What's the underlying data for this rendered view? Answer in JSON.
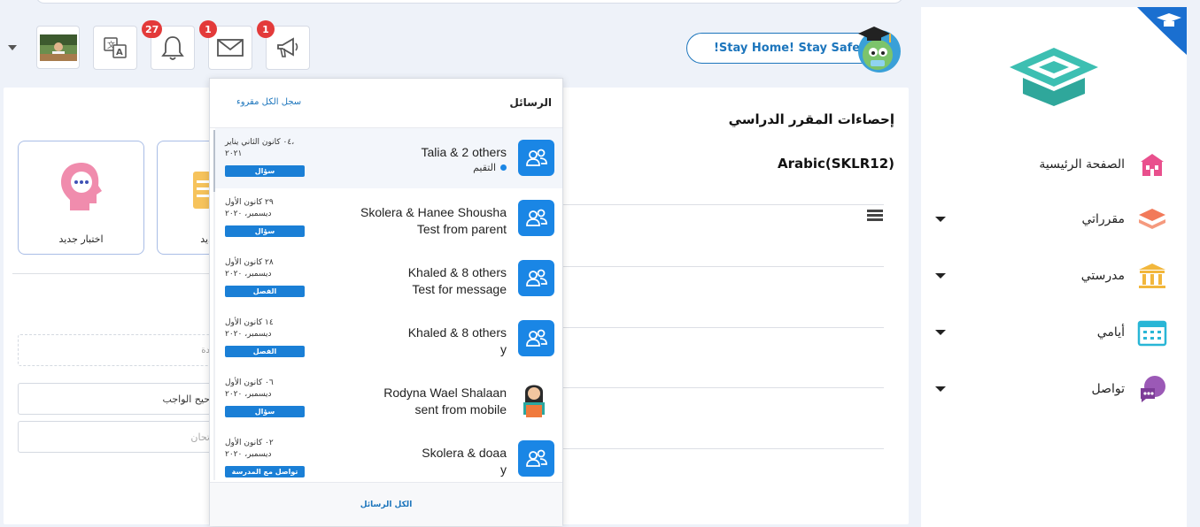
{
  "header": {
    "notifications_count": "27",
    "messages_count": "1",
    "announcements_count": "1",
    "banner_text": "!Stay Home! Stay Safe"
  },
  "sidebar": {
    "items": [
      {
        "label": "الصفحة الرئيسية",
        "icon": "home-icon",
        "color": "#e9508d"
      },
      {
        "label": "مقرراتي",
        "icon": "books-icon",
        "color": "#f27a5a"
      },
      {
        "label": "مدرستي",
        "icon": "school-icon",
        "color": "#f2b73c"
      },
      {
        "label": "أيامي",
        "icon": "calendar-icon",
        "color": "#29b6d6"
      },
      {
        "label": "تواصل",
        "icon": "chat-icon",
        "color": "#9b59b6"
      }
    ]
  },
  "main": {
    "stats_title": "إحصاءات المقرر الدراسي",
    "course_name": "Arabic(SKLR12)",
    "cards": [
      {
        "caption": "اختبار جديد"
      },
      {
        "caption": "ديد"
      }
    ],
    "fields": [
      {
        "text": "دة"
      },
      {
        "text": "حيح الواجب"
      },
      {
        "text": "تحان"
      }
    ]
  },
  "messages_dropdown": {
    "title": "الرسائل",
    "mark_all_read": "سجل الكل مقروء",
    "view_all": "الكل الرسائل",
    "items": [
      {
        "who": "Talia & 2 others",
        "subject": "التقيم",
        "date_line1": "٠٤ كانون الثاني يناير،",
        "date_line2": "٢٠٢١",
        "tag": "سؤال",
        "unread": true,
        "avatar": "group"
      },
      {
        "who": "Skolera & Hanee Shousha",
        "subject": "Test from parent",
        "date_line1": "٢٩ كانون الأول",
        "date_line2": "ديسمبر، ٢٠٢٠",
        "tag": "سؤال",
        "unread": false,
        "avatar": "group"
      },
      {
        "who": "Khaled & 8 others",
        "subject": "Test for message",
        "date_line1": "٢٨ كانون الأول",
        "date_line2": "ديسمبر، ٢٠٢٠",
        "tag": "الفصل",
        "unread": false,
        "avatar": "group"
      },
      {
        "who": "Khaled & 8 others",
        "subject": "y",
        "date_line1": "١٤ كانون الأول",
        "date_line2": "ديسمبر، ٢٠٢٠",
        "tag": "الفصل",
        "unread": false,
        "avatar": "group"
      },
      {
        "who": "Rodyna Wael Shalaan",
        "subject": "sent from mobile",
        "date_line1": "٠٦ كانون الأول",
        "date_line2": "ديسمبر، ٢٠٢٠",
        "tag": "سؤال",
        "unread": false,
        "avatar": "person"
      },
      {
        "who": "Skolera & doaa",
        "subject": "y",
        "date_line1": "٠٢ كانون الأول",
        "date_line2": "ديسمبر، ٢٠٢٠",
        "tag": "تواصل مع المدرسة",
        "unread": false,
        "avatar": "group"
      }
    ]
  }
}
